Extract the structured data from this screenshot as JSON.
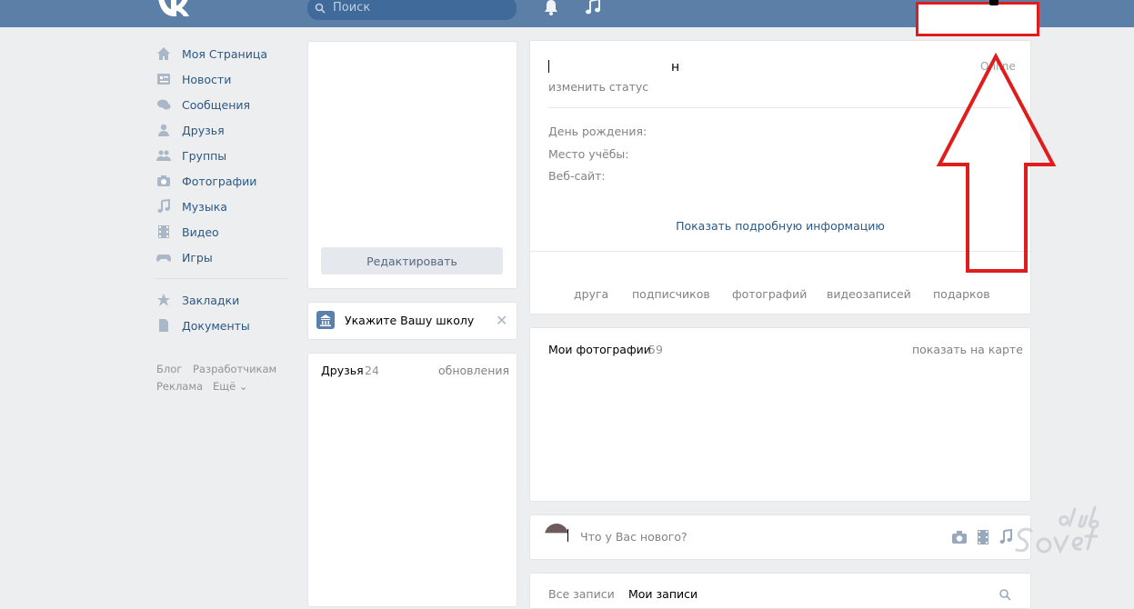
{
  "header": {
    "search_placeholder": "Поиск"
  },
  "sidebar": {
    "items": [
      {
        "label": "Моя Страница",
        "icon": "home-icon"
      },
      {
        "label": "Новости",
        "icon": "news-icon"
      },
      {
        "label": "Сообщения",
        "icon": "messages-icon"
      },
      {
        "label": "Друзья",
        "icon": "user-icon"
      },
      {
        "label": "Группы",
        "icon": "groups-icon"
      },
      {
        "label": "Фотографии",
        "icon": "camera-icon"
      },
      {
        "label": "Музыка",
        "icon": "music-icon"
      },
      {
        "label": "Видео",
        "icon": "film-icon"
      },
      {
        "label": "Игры",
        "icon": "gamepad-icon"
      },
      {
        "label": "Закладки",
        "icon": "star-icon"
      },
      {
        "label": "Документы",
        "icon": "document-icon"
      }
    ],
    "footer": [
      "Блог",
      "Разработчикам",
      "Реклама",
      "Ещё ⌄"
    ]
  },
  "profile": {
    "edit_label": "Редактировать",
    "school_prompt": "Укажите Вашу школу",
    "close_glyph": "✕",
    "friends_title": "Друзья",
    "friends_count": "24",
    "friends_updates": "обновления",
    "name_visible": "н",
    "status_link": "изменить статус",
    "online": "Online",
    "info_labels": [
      "День рождения:",
      "Место учёбы:",
      "Веб-сайт:"
    ],
    "more_info": "Показать подробную информацию",
    "counters": [
      "друга",
      "подписчиков",
      "фотографий",
      "видеозаписей",
      "подарков"
    ],
    "photos_title": "Мои фотографии",
    "photos_count": "59",
    "photos_map": "показать на карте",
    "post_placeholder": "Что у Вас нового?",
    "wall_tabs": [
      "Все записи",
      "Мои записи"
    ]
  },
  "colors": {
    "header": "#5b7fa6",
    "link": "#2a5885",
    "annotation": "#e01c1c",
    "background": "#edeef0"
  },
  "watermark_text": "club Sovet"
}
